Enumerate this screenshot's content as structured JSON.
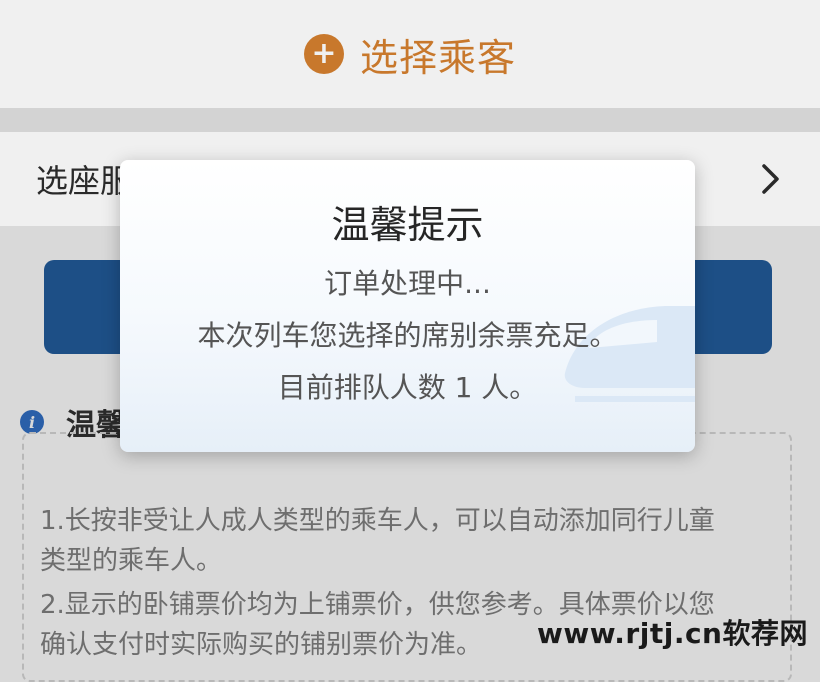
{
  "header": {
    "add_icon": "plus-circle-icon",
    "select_passenger_label": "选择乘客",
    "accent_color": "#c8782c"
  },
  "seat_row": {
    "label": "选座服",
    "chevron_icon": "chevron-right-icon"
  },
  "submit_button": {
    "color": "#1d4f86"
  },
  "tips": {
    "icon": "info-icon",
    "heading": "温馨",
    "lines": [
      "1.长按非受让人成人类型的乘车人，可以自动添加同行儿童",
      "类型的乘车人。",
      "2.显示的卧铺票价均为上铺票价，供您参考。具体票价以您",
      "确认支付时实际购买的铺别票价为准。"
    ]
  },
  "dialog": {
    "title": "温馨提示",
    "lines": [
      "订单处理中...",
      "本次列车您选择的席别余票充足。",
      "目前排队人数 1 人。"
    ],
    "watermark_icon": "train-icon"
  },
  "watermark": {
    "text": "www.rjtj.cn软荐网"
  }
}
